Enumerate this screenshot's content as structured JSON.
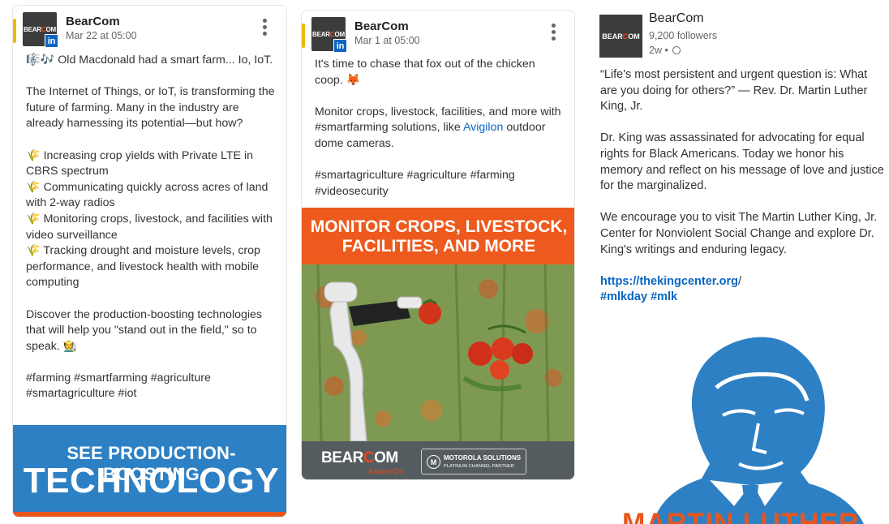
{
  "posts": [
    {
      "author": "BearCom",
      "meta": "Mar 22 at 05:00",
      "logo_text": "BEARCOM",
      "badge": "in",
      "paragraphs": [
        "🎼🎶 Old Macdonald had a smart farm... Io, IoT.",
        "The Internet of Things, or IoT, is transforming the future of farming. Many in the industry are already harnessing its potential—but how?",
        "🌾 Increasing crop yields with Private LTE in CBRS spectrum\n🌾 Communicating quickly across acres of land with 2-way radios\n🌾 Monitoring crops, livestock, and facilities with video surveillance\n🌾 Tracking drought and moisture levels, crop performance, and livestock health with mobile computing",
        "Discover the production-boosting technologies that will help you \"stand out in the field,\" so to speak. 🧑‍🌾",
        "#farming #smartfarming #agriculture #smartagriculture #iot"
      ],
      "banner_line1": "SEE PRODUCTION-BOOSTING",
      "banner_line2": "TECHNOLOGY"
    },
    {
      "author": "BearCom",
      "meta": "Mar 1 at 05:00",
      "logo_text": "BEARCOM",
      "badge": "in",
      "p1": "It's time to chase that fox out of the chicken coop. 🦊",
      "p2_pre": "Monitor crops, livestock, facilities, and more with #smartfarming solutions, like ",
      "p2_link": "Avigilon",
      "p2_post": " outdoor dome cameras.",
      "p3": "#smartagriculture #agriculture #farming #videosecurity",
      "image_line1": "MONITOR CROPS, LIVESTOCK,",
      "image_line2": "FACILITIES, AND MORE",
      "footer_logo": "BEARCOM",
      "footer_tagline": "Always On",
      "partner_name": "MOTOROLA SOLUTIONS",
      "partner_level": "PLATINUM CHANNEL PARTNER"
    },
    {
      "author": "BearCom",
      "followers": "9,200 followers",
      "time": "2w •",
      "logo_text": "BEARCOM",
      "p1": "“Life's most persistent and urgent question is: What are you doing for others?” — Rev. Dr. Martin Luther King, Jr.",
      "p2": "Dr. King was assassinated for advocating for equal rights for Black Americans. Today we honor his memory and reflect on his message of love and justice for the marginalized.",
      "p3": "We encourage you to visit The Martin Luther King, Jr. Center for Nonviolent Social Change and explore Dr. King's writings and enduring legacy.",
      "link": "https://thekingcenter.org",
      "link_suffix": "/",
      "hashtags": "#mlkday #mlk",
      "image_title": "MARTIN LUTHER"
    }
  ],
  "colors": {
    "linkedin_blue": "#0a66c2",
    "bearcom_orange": "#e8561c",
    "banner_blue": "#2e80c4",
    "accent_yellow": "#f2b800"
  },
  "icons": [
    "more-options-icon",
    "linkedin-icon",
    "globe-icon"
  ]
}
